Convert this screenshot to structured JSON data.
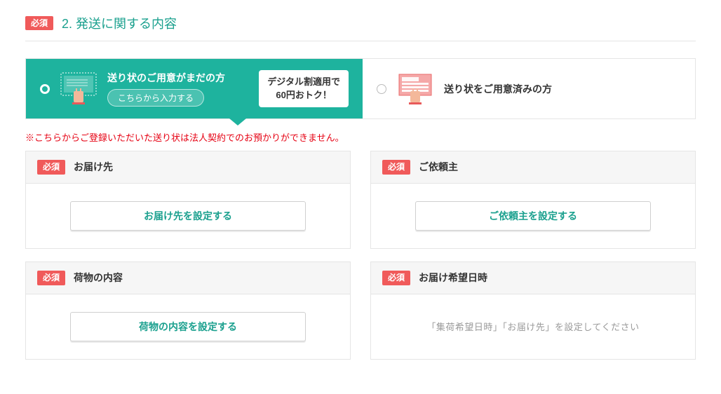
{
  "section": {
    "required_label": "必須",
    "title": "2. 発送に関する内容"
  },
  "tabs": {
    "left": {
      "title": "送り状のご用意がまだの方",
      "enter_here": "こちらから入力する",
      "discount_line1": "デジタル割適用で",
      "discount_line2": "60円おトク！"
    },
    "right": {
      "title": "送り状をご用意済みの方"
    }
  },
  "notice": "※こちらからご登録いただいた送り状は法人契約でのお預かりができません。",
  "cards": {
    "destination": {
      "required": "必須",
      "title": "お届け先",
      "button": "お届け先を設定する"
    },
    "requester": {
      "required": "必須",
      "title": "ご依頼主",
      "button": "ご依頼主を設定する"
    },
    "contents": {
      "required": "必須",
      "title": "荷物の内容",
      "button": "荷物の内容を設定する"
    },
    "delivery_date": {
      "required": "必須",
      "title": "お届け希望日時",
      "placeholder": "「集荷希望日時」「お届け先」を設定してください"
    }
  }
}
